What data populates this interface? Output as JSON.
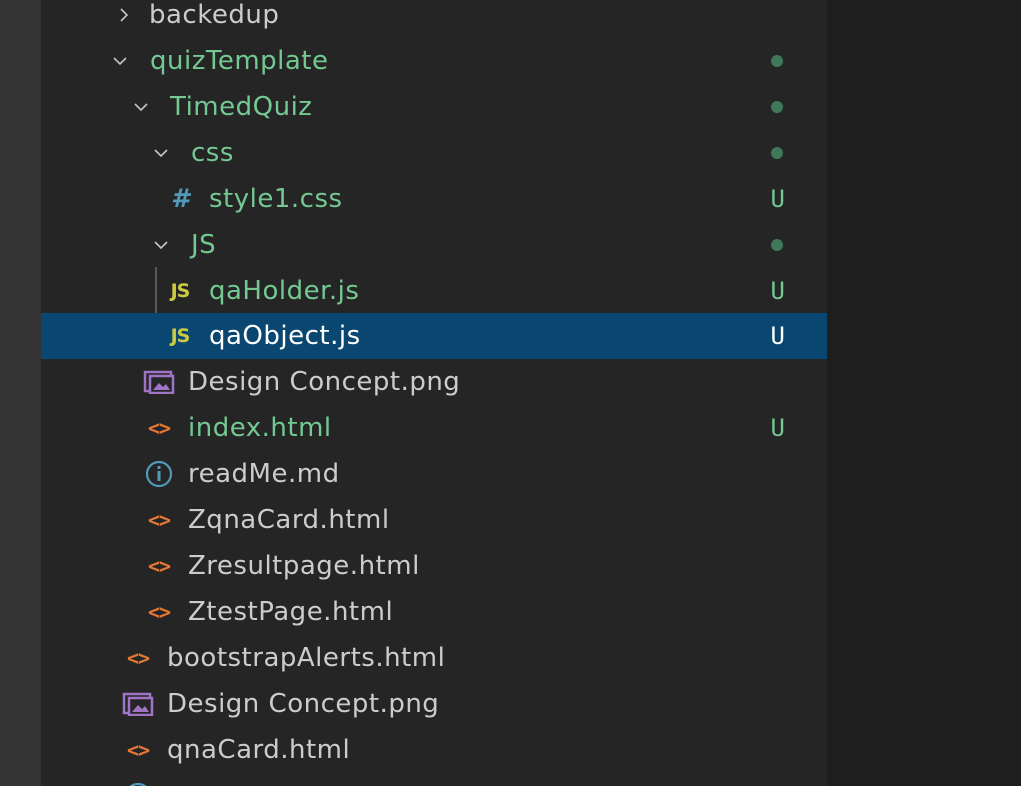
{
  "colors": {
    "tree_bg": "#252526",
    "selection": "#094771",
    "git_green": "#73c991",
    "dot_green": "#3e7a5a",
    "js_yellow": "#cbcb41",
    "css_blue": "#519aba",
    "html_orange": "#e37933",
    "image_purple": "#a074c4",
    "info_blue": "#519aba"
  },
  "tree": {
    "items": [
      {
        "label": "backedup",
        "kind": "folder-collapsed",
        "icon": "chevron-right-icon",
        "git": null
      },
      {
        "label": "quizTemplate",
        "kind": "folder-open",
        "icon": "chevron-down-icon",
        "git": "dot"
      },
      {
        "label": "TimedQuiz",
        "kind": "folder-open",
        "icon": "chevron-down-icon",
        "git": "dot"
      },
      {
        "label": "css",
        "kind": "folder-open",
        "icon": "chevron-down-icon",
        "git": "dot"
      },
      {
        "label": "style1.css",
        "kind": "file",
        "icon": "css-hash-icon",
        "icon_text": "#",
        "git": "U"
      },
      {
        "label": "JS",
        "kind": "folder-open",
        "icon": "chevron-down-icon",
        "git": "dot"
      },
      {
        "label": "qaHolder.js",
        "kind": "file",
        "icon": "js-file-icon",
        "icon_text": "JS",
        "git": "U"
      },
      {
        "label": "qaObject.js",
        "kind": "file",
        "icon": "js-file-icon",
        "icon_text": "JS",
        "git": "U",
        "selected": true
      },
      {
        "label": "Design Concept.png",
        "kind": "file",
        "icon": "image-file-icon",
        "git": null
      },
      {
        "label": "index.html",
        "kind": "file",
        "icon": "html-file-icon",
        "icon_text": "<>",
        "git": "U"
      },
      {
        "label": "readMe.md",
        "kind": "file",
        "icon": "info-icon",
        "git": null
      },
      {
        "label": "ZqnaCard.html",
        "kind": "file",
        "icon": "html-file-icon",
        "icon_text": "<>",
        "git": null
      },
      {
        "label": "Zresultpage.html",
        "kind": "file",
        "icon": "html-file-icon",
        "icon_text": "<>",
        "git": null
      },
      {
        "label": "ZtestPage.html",
        "kind": "file",
        "icon": "html-file-icon",
        "icon_text": "<>",
        "git": null
      },
      {
        "label": "bootstrapAlerts.html",
        "kind": "file",
        "icon": "html-file-icon",
        "icon_text": "<>",
        "git": null
      },
      {
        "label": "Design Concept.png",
        "kind": "file",
        "icon": "image-file-icon",
        "git": null
      },
      {
        "label": "qnaCard.html",
        "kind": "file",
        "icon": "html-file-icon",
        "icon_text": "<>",
        "git": null
      }
    ]
  }
}
